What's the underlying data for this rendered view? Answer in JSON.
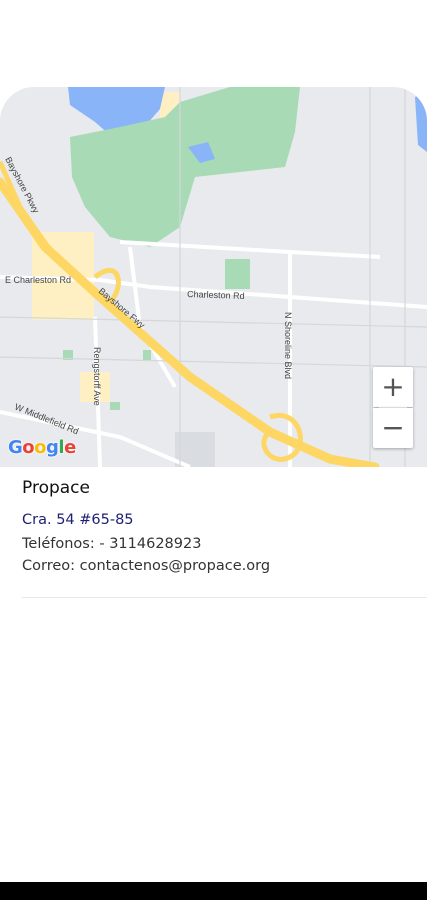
{
  "map": {
    "labels": {
      "charleston_left": "E Charleston Rd",
      "charleston_right": "Charleston Rd",
      "bayshore_fwy": "Bayshore Fwy",
      "bayshore_pkwy": "Bayshore Pkwy",
      "shoreline": "N Shoreline Blvd",
      "rengstorff": "Rengstorff Ave",
      "middlefield": "W Middlefield Rd"
    },
    "zoom_in_icon": "plus-icon",
    "zoom_out_icon": "minus-icon",
    "zoom_in_label": "+",
    "zoom_out_label": "−",
    "attribution": {
      "letters": [
        "G",
        "o",
        "o",
        "g",
        "l",
        "e"
      ],
      "colors": [
        "#4285F4",
        "#EA4335",
        "#FBBC05",
        "#4285F4",
        "#34A853",
        "#EA4335"
      ]
    },
    "colors": {
      "background": "#e8eaed",
      "park": "#a8dab5",
      "water": "#8ab4f8",
      "highway": "#fdd663",
      "urban": "#fef0c3"
    }
  },
  "place": {
    "name": "Propace",
    "address": "Cra. 54 #65-85",
    "phones": "Teléfonos:  - 3114628923",
    "email": "Correo: contactenos@propace.org"
  }
}
